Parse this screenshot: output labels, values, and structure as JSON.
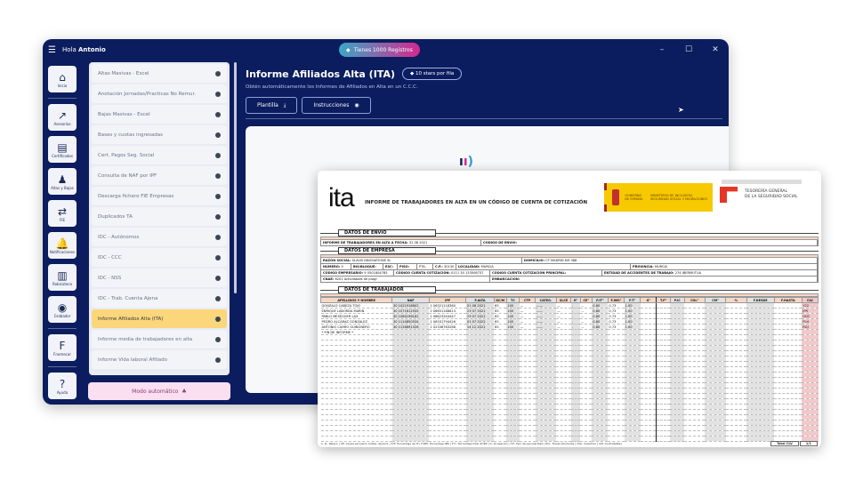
{
  "app": {
    "greeting_prefix": "Hola",
    "user": "Antonio",
    "records_badge": "Tienes 1000 Registros"
  },
  "window_controls": {
    "minimize": "–",
    "maximize": "☐",
    "close": "✕"
  },
  "rail": [
    {
      "label": "Inicio",
      "icon": "home-icon",
      "glyph": "⌂"
    },
    {
      "label": "Asesorías",
      "icon": "route-icon",
      "glyph": "↗"
    },
    {
      "label": "Certificados",
      "icon": "certificate-icon",
      "glyph": "▤"
    },
    {
      "label": "Altas y Bajas",
      "icon": "person-icon",
      "glyph": "♟"
    },
    {
      "label": "FIE",
      "icon": "transfer-icon",
      "glyph": "⇄"
    },
    {
      "label": "Notificaciones",
      "icon": "bell-icon",
      "glyph": "🔔"
    },
    {
      "label": "Robicoteca",
      "icon": "library-icon",
      "glyph": "▥"
    },
    {
      "label": "Grabador",
      "icon": "record-icon",
      "glyph": "◉"
    },
    {
      "label": "Fnomecar",
      "icon": "fnmt-icon",
      "glyph": "F"
    },
    {
      "label": "Ayuda",
      "icon": "help-icon",
      "glyph": "?"
    }
  ],
  "list": {
    "items": [
      "Altas Masivas - Excel",
      "Anotación Jornadas/Practicas No Remur.",
      "Bajas Masivas - Excel",
      "Bases y cuotas ingresadas",
      "Cert. Pagos Seg. Social",
      "Consulta de NAF por IPF",
      "Descarga fichero FIE Empresas",
      "Duplicados TA",
      "IDC - Autónomos",
      "IDC - CCC",
      "IDC - NSS",
      "IDC - Trab. Cuenta Ajena",
      "Informe Afiliados Alta (ITA)",
      "Informe media de trabajadores en alta",
      "Informe Vida laboral Afiliado"
    ],
    "active": "Informe Afiliados Alta (ITA)",
    "auto_mode": "Modo automático"
  },
  "main": {
    "title": "Informe Afiliados Alta (ITA)",
    "stars": "10 stars por fila",
    "subtitle": "Obtén automáticamente los Informes de Afiliados en Alta en un C.C.C.",
    "template_button": "Plantilla",
    "instructions_button": "Instrucciones"
  },
  "doc": {
    "logo": "ita",
    "title": "INFORME DE TRABAJADORES EN ALTA EN UN CÓDIGO DE CUENTA DE COTIZACIÓN",
    "gob1": "GOBIERNO DE ESPAÑA",
    "gob2": "MINISTERIO DE INCLUSIÓN, SEGURIDAD SOCIAL Y MIGRACIONES",
    "tgss1": "TESORERÍA GENERAL",
    "tgss2": "DE LA SEGURIDAD SOCIAL",
    "envio": {
      "header": "DATOS DE ENVIO",
      "fecha_label": "INFORME DE TRABAJADORES EN ALTA A FECHA:",
      "fecha": "31 08 2021",
      "codigo_label": "CODIGO DE ENVIO:"
    },
    "empresa": {
      "header": "DATOS DE EMPRESA",
      "razon_label": "RAZÓN SOCIAL:",
      "razon": "SLAVIS INNOVATIONS SL",
      "domicilio_label": "DOMICILIO:",
      "domicilio": "CT MADRID KM 388",
      "numero_label": "NUMERO:",
      "numero": "3",
      "bis_label": "BIS/BLOQUE:",
      "esc_label": "ESC:",
      "piso_label": "PISO:",
      "pta_label": "PTA:",
      "cp_label": "C.P.:",
      "cp": "30130",
      "localidad_label": "LOCALIDAD:",
      "localidad": "MURCIA",
      "provincia_label": "PROVINCIA:",
      "provincia": "MURCIA",
      "codemp_label": "CÓDIGO EMPRESARIO:",
      "codemp": "9 0501804785",
      "ccc_label": "CÓDIGO CUENTA COTIZACIÓN:",
      "ccc": "0111 30 133508737",
      "cccp_label": "CÓDIGO CUENTA COTIZACIÓN PRINCIPAL:",
      "entidad_label": "ENTIDAD DE ACCIDENTES DE TRABAJO:",
      "entidad": "274 IBERMUTUA",
      "cnae_label": "CNAE:",
      "cnae": "6201 Actividades de progr",
      "embarcacion_label": "EMBARCACIÓN:"
    },
    "trabajador": {
      "header": "DATOS DE TRABAJADOR",
      "columns": [
        "APELLIDOS Y NOMBRE",
        "NAF",
        "IPF",
        "F.ALTA",
        "GC/M",
        "TC",
        "CTP",
        "CATEG.",
        "SLCE",
        "R°",
        "CE°",
        "F.IT°",
        "F.IMS°",
        "F.T°",
        "G°",
        "T.P°",
        "P.IC",
        "COL°",
        "CM°",
        "%",
        "F.DESDE",
        "F.HASTA",
        "CLV"
      ],
      "rows": [
        [
          "GONZALO CABEZA TOJO",
          "30 1021916802",
          "1 06321118360",
          "01 08 2021",
          "65",
          "100",
          "—",
          "——",
          "—",
          "-",
          "--",
          "0,80",
          "0,73",
          "1,00",
          "",
          "",
          "",
          "",
          "",
          "",
          "",
          "",
          "Y22"
        ],
        [
          "ENRIQUE LABORDA MARIN",
          "30 1071612555",
          "1 06651188813",
          "23 07 2021",
          "65",
          "100",
          "—",
          "——",
          "—",
          "-",
          "--",
          "0,80",
          "0,73",
          "1,00",
          "",
          "",
          "",
          "",
          "",
          "",
          "",
          "",
          "JPR"
        ],
        [
          "PABLO MESEGUER LAX",
          "30 1084196162",
          "1 06823344447",
          "23 07 2021",
          "65",
          "100",
          "—",
          "——",
          "—",
          "-",
          "--",
          "0,80",
          "0,73",
          "1,00",
          "",
          "",
          "",
          "",
          "",
          "",
          "",
          "",
          "GDC"
        ],
        [
          "PEDRO ALCARAZ GONZALEZ",
          "30 1114850534",
          "1 06331794426",
          "01 07 2022",
          "65",
          "100",
          "—",
          "——",
          "—",
          "-",
          "--",
          "0,80",
          "0,73",
          "1,00",
          "",
          "",
          "",
          "",
          "",
          "",
          "",
          "",
          "PLH"
        ],
        [
          "ANTONIO CARRO GUIÑONERO",
          "30 1126691326",
          "1 02336763268",
          "14 12 2021",
          "65",
          "100",
          "—",
          "——",
          "—",
          "-",
          "--",
          "0,80",
          "0,73",
          "1,00",
          "",
          "",
          "",
          "",
          "",
          "",
          "",
          "",
          "RGJ"
        ],
        [
          "* FIN DE INFORME *",
          "",
          "",
          "",
          "",
          "",
          "",
          "",
          "",
          "",
          "",
          "",
          "",
          "",
          "",
          "",
          "",
          "",
          "",
          "",
          "",
          "",
          ""
        ]
      ]
    },
    "footer": "1. R.: Relevo | CE: Causa exclusión Cotiza. Aprend. | F.IT: Porcentaje de IT | F.IMS: Porcentaje IMS | F.T.: Porcentaje total AT/EP | G: Ocupación | T.P: Tipo de peculiaridad | P.IC: Transición/Cuota | COL: Colectivo | CM: Contratables",
    "total_label": "Total CLV",
    "page": "1/1"
  }
}
